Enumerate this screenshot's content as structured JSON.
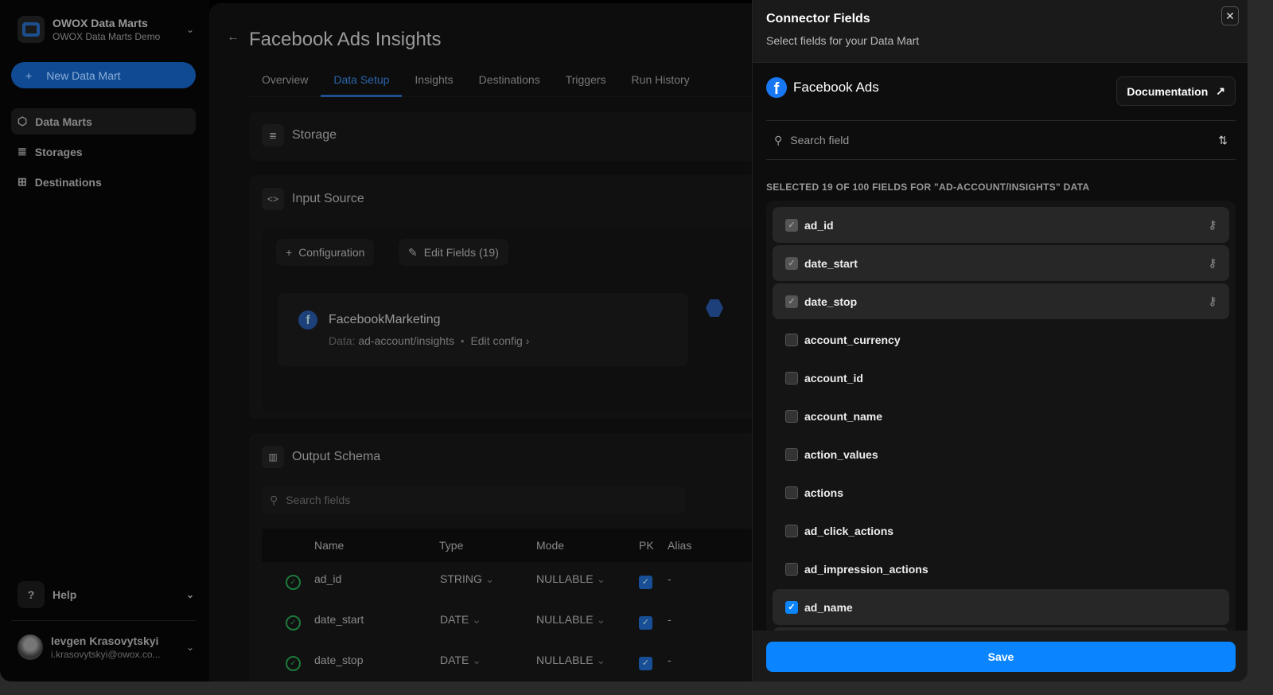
{
  "sidebar": {
    "workspace_title": "OWOX Data Marts",
    "workspace_subtitle": "OWOX Data Marts Demo",
    "new_button": "New Data Mart",
    "items": [
      {
        "label": "Data Marts"
      },
      {
        "label": "Storages"
      },
      {
        "label": "Destinations"
      }
    ],
    "help": "Help",
    "user_name": "Ievgen Krasovytskyi",
    "user_email": "i.krasovytskyi@owox.co..."
  },
  "main": {
    "title": "Facebook Ads Insights",
    "tabs": [
      "Overview",
      "Data Setup",
      "Insights",
      "Destinations",
      "Triggers",
      "Run History"
    ],
    "storage": "Storage",
    "input_source": "Input Source",
    "configuration": "Configuration",
    "edit_fields": "Edit Fields (19)",
    "source_name": "FacebookMarketing",
    "data_label": "Data:",
    "data_value": "ad-account/insights",
    "dot": "•",
    "edit_config": "Edit config",
    "output_schema": "Output Schema",
    "search_placeholder": "Search fields",
    "columns": [
      "Name",
      "Type",
      "Mode",
      "PK",
      "Alias"
    ],
    "rows": [
      {
        "name": "ad_id",
        "type": "STRING",
        "mode": "NULLABLE",
        "alias": "-"
      },
      {
        "name": "date_start",
        "type": "DATE",
        "mode": "NULLABLE",
        "alias": "-"
      },
      {
        "name": "date_stop",
        "type": "DATE",
        "mode": "NULLABLE",
        "alias": "-"
      }
    ]
  },
  "drawer": {
    "title": "Connector Fields",
    "subtitle": "Select fields for your Data Mart",
    "connector": "Facebook Ads",
    "documentation": "Documentation",
    "search_placeholder": "Search field",
    "selected_text": "SELECTED 19 OF 100 FIELDS FOR \"AD-ACCOUNT/INSIGHTS\" DATA",
    "save": "Save",
    "fields": [
      {
        "name": "ad_id",
        "state": "required"
      },
      {
        "name": "date_start",
        "state": "required"
      },
      {
        "name": "date_stop",
        "state": "required"
      },
      {
        "name": "account_currency",
        "state": "off"
      },
      {
        "name": "account_id",
        "state": "off"
      },
      {
        "name": "account_name",
        "state": "off"
      },
      {
        "name": "action_values",
        "state": "off"
      },
      {
        "name": "actions",
        "state": "off"
      },
      {
        "name": "ad_click_actions",
        "state": "off"
      },
      {
        "name": "ad_impression_actions",
        "state": "off"
      },
      {
        "name": "ad_name",
        "state": "on"
      }
    ]
  }
}
